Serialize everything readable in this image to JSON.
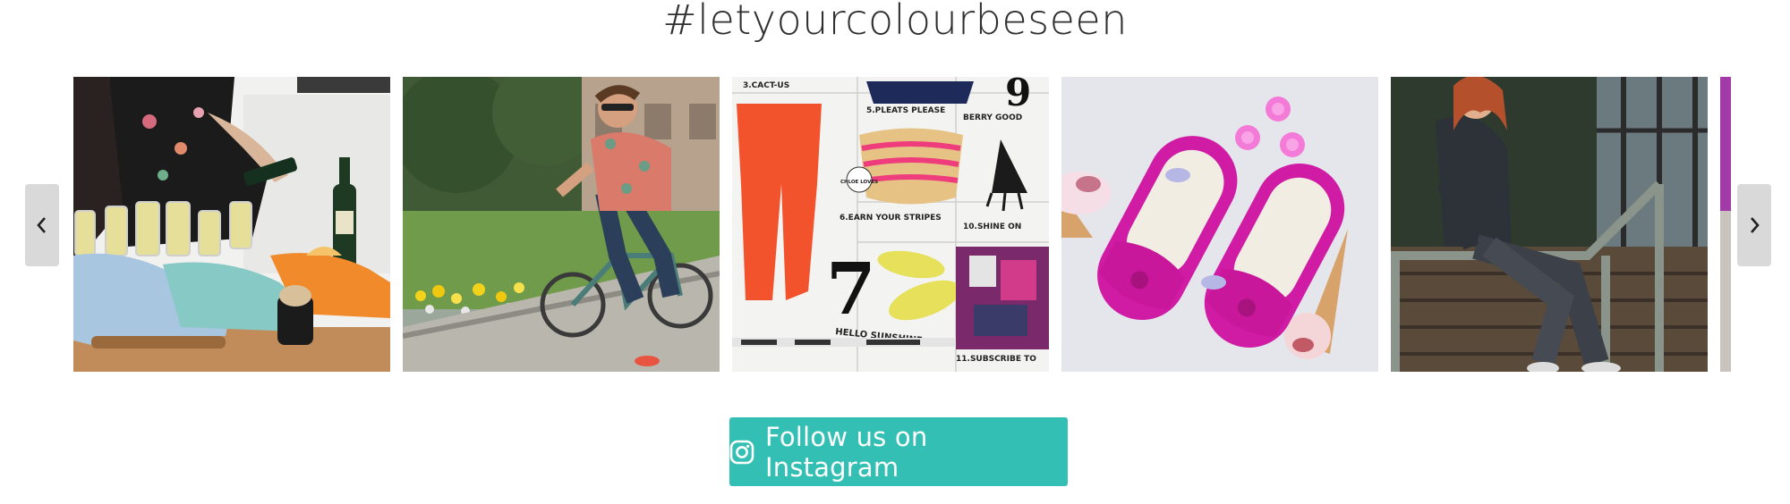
{
  "section": {
    "hashtag": "#letyourcolourbeseen"
  },
  "carousel": {
    "prev_icon": "chevron-left-icon",
    "next_icon": "chevron-right-icon",
    "tiles": [
      {
        "id": "party-loafers"
      },
      {
        "id": "bicycle-man"
      },
      {
        "id": "magazine-page"
      },
      {
        "id": "pink-loafers"
      },
      {
        "id": "woman-railing"
      },
      {
        "id": "partial-tile"
      }
    ],
    "magazine_text": {
      "item3": "3.CACT-US",
      "item5": "5.PLEATS PLEASE",
      "item9": "9",
      "item9_label": "BERRY GOOD",
      "item6": "6.EARN YOUR STRIPES",
      "item10": "10.SHINE ON",
      "item7": "7",
      "item7_label": "HELLO SUNSHINE",
      "item11": "11.SUBSCRIBE TO",
      "badge": "CHLOE LOVES"
    }
  },
  "follow_button": {
    "label": "Follow us on Instagram",
    "icon": "instagram-icon",
    "color": "#33bfb3"
  }
}
